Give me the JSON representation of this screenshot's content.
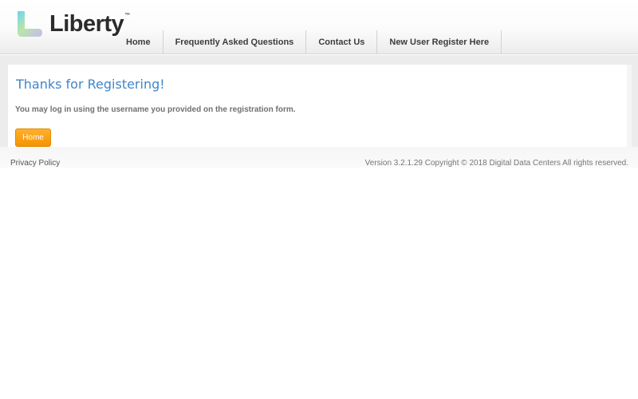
{
  "brand": {
    "name": "Liberty",
    "trademark": "™",
    "logo_icon": "liberty-heart-logo"
  },
  "nav": {
    "items": [
      {
        "label": "Home"
      },
      {
        "label": "Frequently Asked Questions"
      },
      {
        "label": "Contact Us"
      },
      {
        "label": "New User Register Here"
      }
    ]
  },
  "main": {
    "title": "Thanks for Registering!",
    "message": "You may log in using the username you provided on the registration form.",
    "home_button": "Home"
  },
  "footer": {
    "privacy_link": "Privacy Policy",
    "copyright": "Version 3.2.1.29 Copyright © 2018 Digital Data Centers All rights reserved."
  },
  "colors": {
    "accent_orange": "#f59300",
    "title_blue": "#3f86c8"
  }
}
